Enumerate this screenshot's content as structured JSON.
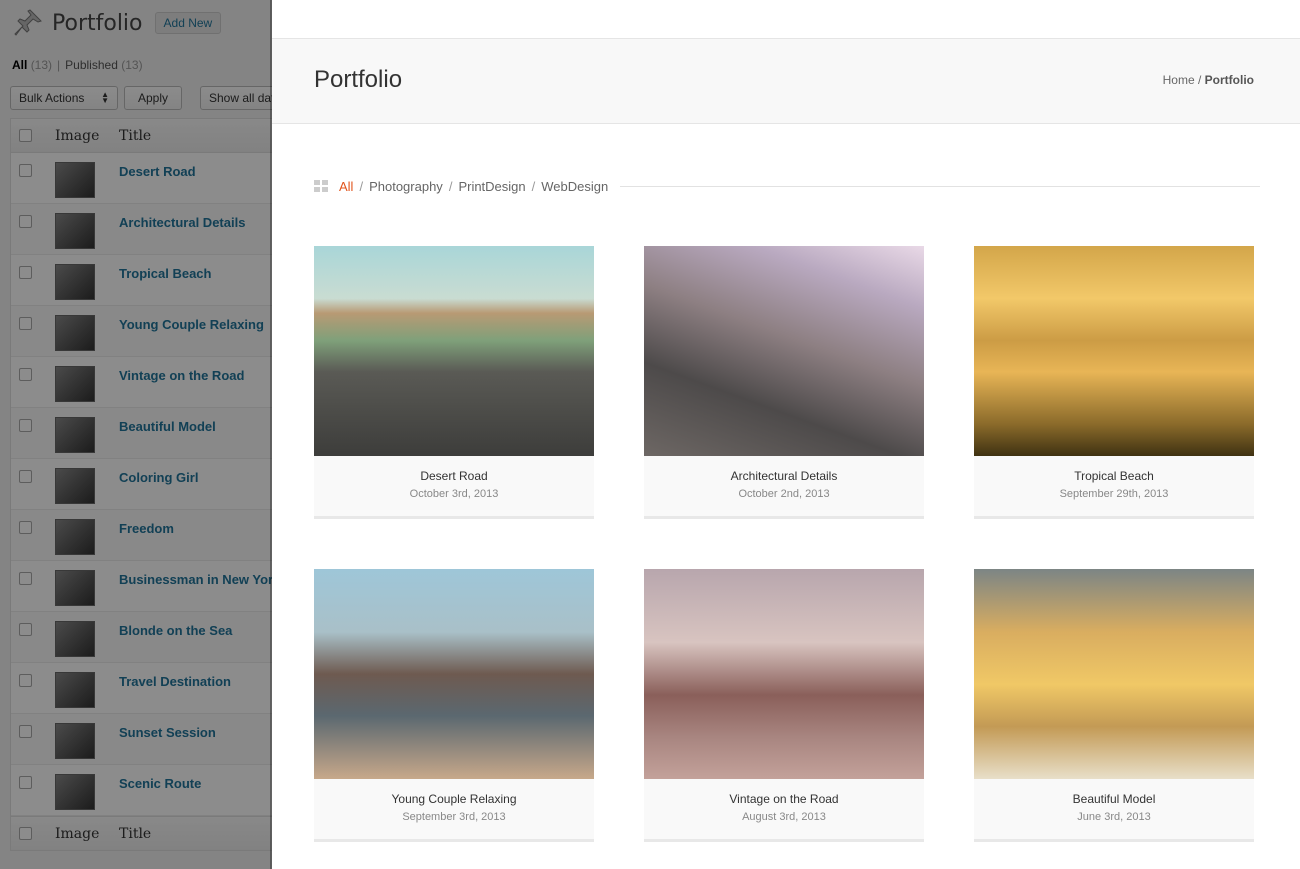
{
  "admin": {
    "title": "Portfolio",
    "add_new": "Add New",
    "filters": {
      "all_label": "All",
      "all_count": "(13)",
      "separator": "|",
      "published_label": "Published",
      "published_count": "(13)"
    },
    "bulk_actions": "Bulk Actions",
    "apply": "Apply",
    "show_all_dates": "Show all dates",
    "columns": {
      "image": "Image",
      "title": "Title"
    },
    "rows": [
      "Desert Road",
      "Architectural Details",
      "Tropical Beach",
      "Young Couple Relaxing",
      "Vintage on the Road",
      "Beautiful Model",
      "Coloring Girl",
      "Freedom",
      "Businessman in New York",
      "Blonde on the Sea",
      "Travel Destination",
      "Sunset Session",
      "Scenic Route"
    ]
  },
  "front": {
    "page_title": "Portfolio",
    "breadcrumb": {
      "home": "Home",
      "separator": " / ",
      "current": "Portfolio"
    },
    "filters": {
      "all": "All",
      "separator": "/",
      "items": [
        "Photography",
        "PrintDesign",
        "WebDesign"
      ]
    },
    "items": [
      {
        "title": "Desert Road",
        "date": "October 3rd, 2013"
      },
      {
        "title": "Architectural Details",
        "date": "October 2nd, 2013"
      },
      {
        "title": "Tropical Beach",
        "date": "September 29th, 2013"
      },
      {
        "title": "Young Couple Relaxing",
        "date": "September 3rd, 2013"
      },
      {
        "title": "Vintage on the Road",
        "date": "August 3rd, 2013"
      },
      {
        "title": "Beautiful Model",
        "date": "June 3rd, 2013"
      }
    ]
  },
  "colors": {
    "accent": "#e1541c",
    "admin_link": "#21759b",
    "overlay": "rgba(0,0,0,0.45)"
  },
  "icons": {
    "admin_header": "pushpin-icon",
    "filter": "grid-icon",
    "select": "select-arrows-icon"
  }
}
